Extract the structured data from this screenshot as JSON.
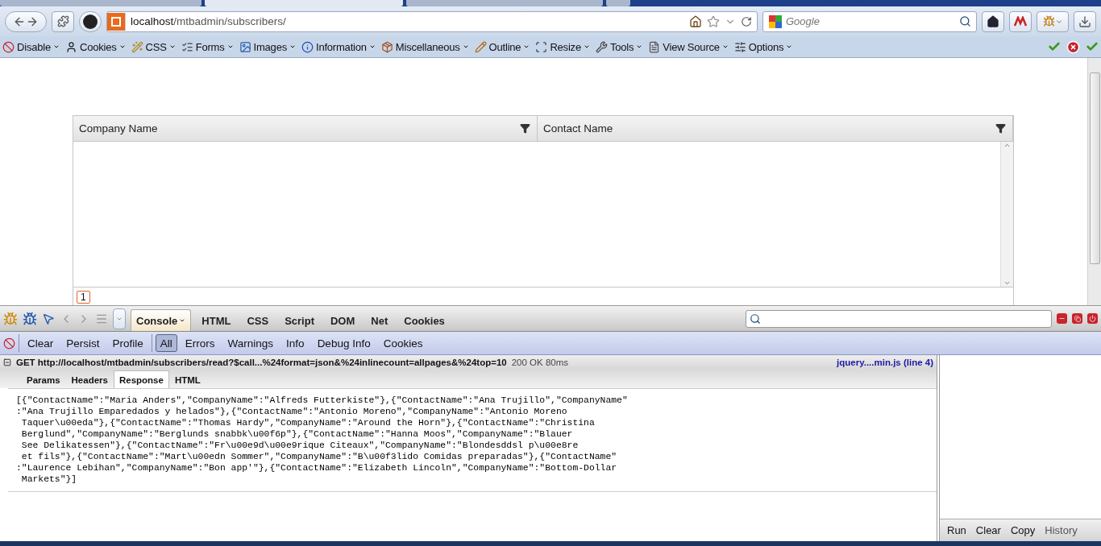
{
  "browser_tabs": [
    {
      "selected": false
    },
    {
      "selected": true
    },
    {
      "selected": false
    }
  ],
  "address_bar": {
    "host": "localhost",
    "path": "/mtbadmin/subscribers/"
  },
  "search_bar": {
    "placeholder": "Google"
  },
  "dev_toolbar": {
    "items": [
      {
        "label": "Disable"
      },
      {
        "label": "Cookies"
      },
      {
        "label": "CSS"
      },
      {
        "label": "Forms"
      },
      {
        "label": "Images"
      },
      {
        "label": "Information"
      },
      {
        "label": "Miscellaneous"
      },
      {
        "label": "Outline"
      },
      {
        "label": "Resize"
      },
      {
        "label": "Tools"
      },
      {
        "label": "View Source"
      },
      {
        "label": "Options"
      }
    ]
  },
  "grid": {
    "columns": [
      "Company Name",
      "Contact Name"
    ],
    "pages": [
      {
        "label": "1",
        "selected": true
      }
    ]
  },
  "firebug": {
    "tabs": [
      {
        "label": "Console",
        "selected": true,
        "menu": true
      },
      {
        "label": "HTML",
        "selected": false,
        "menu": false
      },
      {
        "label": "CSS",
        "selected": false,
        "menu": false
      },
      {
        "label": "Script",
        "selected": false,
        "menu": false
      },
      {
        "label": "DOM",
        "selected": false,
        "menu": false
      },
      {
        "label": "Net",
        "selected": false,
        "menu": false
      },
      {
        "label": "Cookies",
        "selected": false,
        "menu": false
      }
    ]
  },
  "console_toolbar": {
    "buttons": [
      "Clear",
      "Persist",
      "Profile"
    ],
    "filters": [
      {
        "label": "All",
        "selected": true
      },
      {
        "label": "Errors",
        "selected": false
      },
      {
        "label": "Warnings",
        "selected": false
      },
      {
        "label": "Info",
        "selected": false
      },
      {
        "label": "Debug Info",
        "selected": false
      },
      {
        "label": "Cookies",
        "selected": false
      }
    ]
  },
  "request": {
    "expanded": true,
    "line": "GET http://localhost/mtbadmin/subscribers/read?$call...%24format=json&%24inlinecount=allpages&%24top=10",
    "status": "200 OK 80ms",
    "source": "jquery....min.js (line 4)"
  },
  "request_tabs": [
    {
      "label": "Params",
      "selected": false
    },
    {
      "label": "Headers",
      "selected": false
    },
    {
      "label": "Response",
      "selected": true
    },
    {
      "label": "HTML",
      "selected": false
    }
  ],
  "response_lines": [
    "[{\"ContactName\":\"Maria Anders\",\"CompanyName\":\"Alfreds Futterkiste\"},{\"ContactName\":\"Ana Trujillo\",\"CompanyName\"",
    ":\"Ana Trujillo Emparedados y helados\"},{\"ContactName\":\"Antonio Moreno\",\"CompanyName\":\"Antonio Moreno",
    " Taquer\\u00eda\"},{\"ContactName\":\"Thomas Hardy\",\"CompanyName\":\"Around the Horn\"},{\"ContactName\":\"Christina",
    " Berglund\",\"CompanyName\":\"Berglunds snabbk\\u00f6p\"},{\"ContactName\":\"Hanna Moos\",\"CompanyName\":\"Blauer",
    " See Delikatessen\"},{\"ContactName\":\"Fr\\u00e9d\\u00e9rique Citeaux\",\"CompanyName\":\"Blondesddsl p\\u00e8re",
    " et fils\"},{\"ContactName\":\"Mart\\u00edn Sommer\",\"CompanyName\":\"B\\u00f3lido Comidas preparadas\"},{\"ContactName\"",
    ":\"Laurence Lebihan\",\"CompanyName\":\"Bon app'\"},{\"ContactName\":\"Elizabeth Lincoln\",\"CompanyName\":\"Bottom-Dollar",
    " Markets\"}]"
  ],
  "command_panel": {
    "buttons": [
      "Run",
      "Clear",
      "Copy",
      "History"
    ]
  }
}
